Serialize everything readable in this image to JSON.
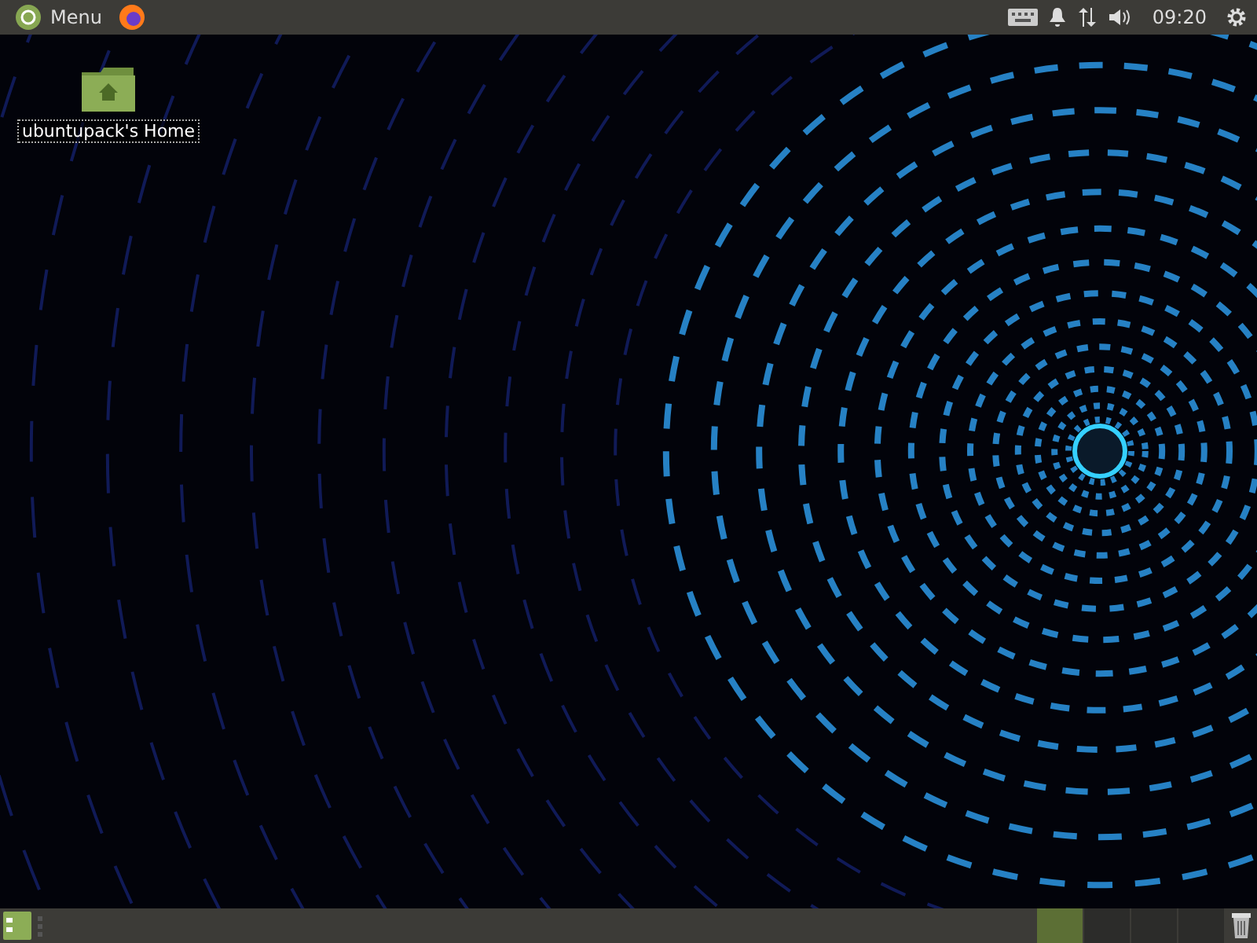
{
  "top_panel": {
    "menu_label": "Menu",
    "clock": "09:20"
  },
  "desktop_icons": [
    {
      "label": "ubuntupack's Home"
    }
  ],
  "workspaces": [
    {
      "selected": true
    },
    {
      "selected": false
    },
    {
      "selected": false
    },
    {
      "selected": false
    }
  ]
}
